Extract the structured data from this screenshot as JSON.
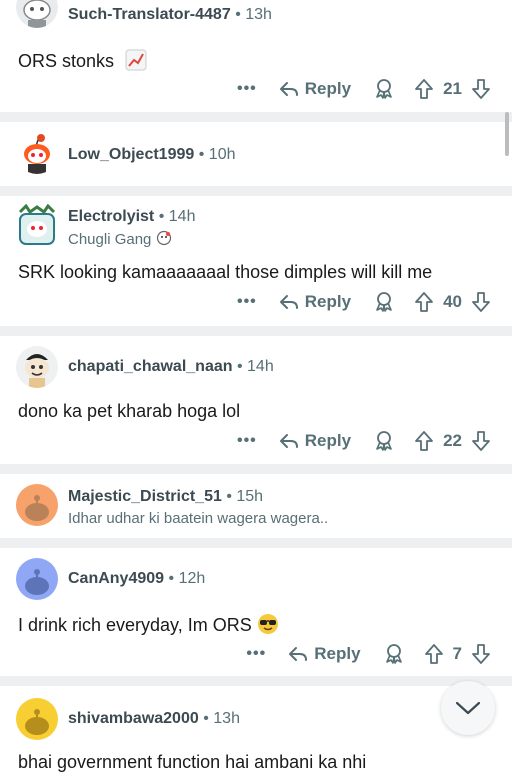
{
  "comments": [
    {
      "username": "Such-Translator-4487",
      "time": "13h",
      "body": "ORS stonks",
      "body_emoji": "chart-increasing-icon",
      "reply_label": "Reply",
      "score": "21",
      "more": "•••"
    },
    {
      "username": "Low_Object1999",
      "time": "10h"
    },
    {
      "username": "Electrolyist",
      "time": "14h",
      "flair": "Chugli Gang",
      "flair_emoji": "face-icon",
      "body": "SRK looking kamaaaaaaal those dimples will kill me",
      "reply_label": "Reply",
      "score": "40",
      "more": "•••"
    },
    {
      "username": "chapati_chawal_naan",
      "time": "14h",
      "body": "dono ka pet kharab hoga lol",
      "reply_label": "Reply",
      "score": "22",
      "more": "•••"
    },
    {
      "username": "Majestic_District_51",
      "time": "15h",
      "flair": "Idhar udhar ki baatein wagera wagera.."
    },
    {
      "username": "CanAny4909",
      "time": "12h",
      "body": "I drink rich everyday, Im ORS",
      "body_emoji": "sunglasses-face-icon",
      "reply_label": "Reply",
      "score": "7",
      "more": "•••"
    },
    {
      "username": "shivambawa2000",
      "time": "13h",
      "body": "bhai government function hai ambani ka nhi"
    }
  ],
  "separator": "•",
  "scroll_down_button": "chevron-down-icon",
  "colors": {
    "separator_bg": "#edeff1",
    "meta_text": "#576f76",
    "avatar_orange": "#f7a26a",
    "avatar_blue": "#8fa7f5",
    "avatar_yellow": "#f7cf33"
  }
}
